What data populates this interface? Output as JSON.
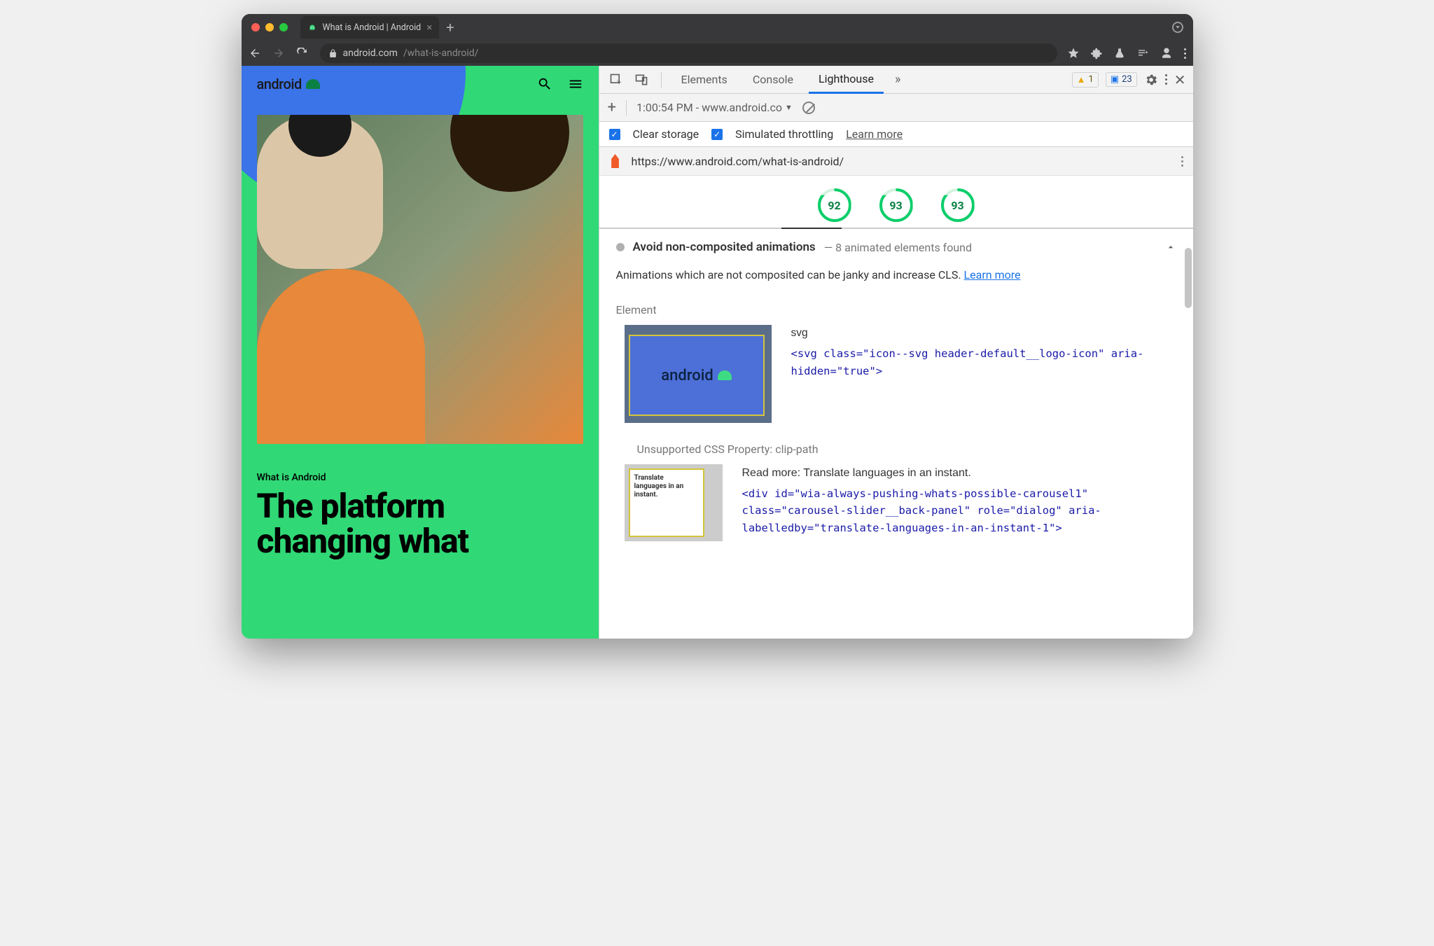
{
  "browser": {
    "tab_title": "What is Android | Android",
    "url_host": "android.com",
    "url_path": "/what-is-android/"
  },
  "page": {
    "brand": "android",
    "eyebrow": "What is Android",
    "headline": "The platform changing what"
  },
  "devtools": {
    "tabs": {
      "elements": "Elements",
      "console": "Console",
      "lighthouse": "Lighthouse"
    },
    "badges": {
      "warnings": "1",
      "messages": "23"
    },
    "report_dropdown": "1:00:54 PM - www.android.co",
    "clear_storage": "Clear storage",
    "simulated_throttling": "Simulated throttling",
    "learn_more": "Learn more",
    "audited_url": "https://www.android.com/what-is-android/",
    "scores": [
      "92",
      "93",
      "93"
    ]
  },
  "audit": {
    "title": "Avoid non-composited animations",
    "subtitle_prefix": "—  ",
    "subtitle": "8 animated elements found",
    "description_1": "Animations which are not composited can be janky and increase CLS. ",
    "description_link": "Learn more",
    "element_label": "Element",
    "el1": {
      "thumb_text": "android",
      "name": "svg",
      "code": "<svg class=\"icon--svg header-default__logo-icon\" aria-hidden=\"true\">"
    },
    "unsupported_label": "Unsupported CSS Property: clip-path",
    "el2": {
      "thumb_line1": "Translate",
      "thumb_line2": "languages in an",
      "thumb_line3": "instant.",
      "readmore": "Read more: Translate languages in an instant.",
      "code": "<div id=\"wia-always-pushing-whats-possible-carousel1\" class=\"carousel-slider__back-panel\" role=\"dialog\" aria-labelledby=\"translate-languages-in-an-instant-1\">"
    }
  }
}
